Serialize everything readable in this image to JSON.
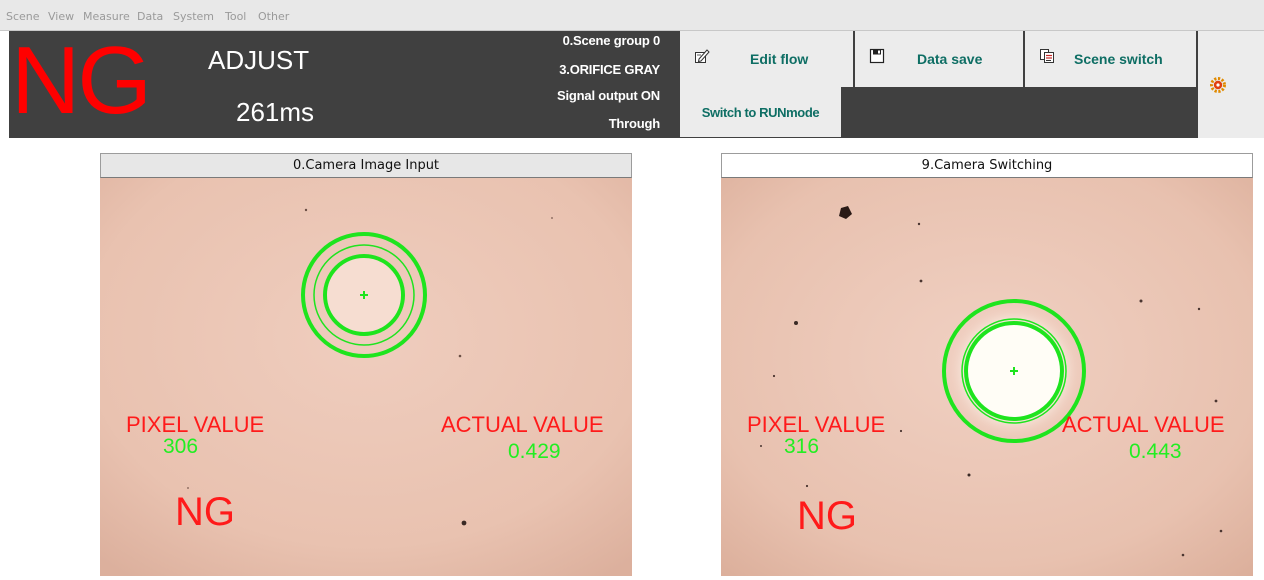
{
  "menu": [
    "Scene",
    "View",
    "Measure",
    "Data",
    "System",
    "Tool",
    "Other"
  ],
  "status": {
    "judgement": "NG",
    "mode": "ADJUST",
    "processing_time": "261ms",
    "scene_group": "0.Scene group 0",
    "scene": "3.ORIFICE GRAY",
    "signal_output": "Signal output ON",
    "through": "Through"
  },
  "toolbar": {
    "edit_flow": "Edit flow",
    "data_save": "Data save",
    "scene_switch": "Scene switch",
    "switch_mode": "Switch to RUNmode"
  },
  "colors": {
    "ng": "#ff0000",
    "overlay_label": "#ff1a1a",
    "overlay_value": "#22ee22",
    "button_text": "#0e6e64",
    "status_bar": "#404040"
  },
  "panes": [
    {
      "title": "0.Camera Image Input",
      "pixel_label": "PIXEL VALUE",
      "pixel_value": "306",
      "actual_label": "ACTUAL VALUE",
      "actual_value": "0.429",
      "judgement": "NG"
    },
    {
      "title": "9.Camera Switching",
      "pixel_label": "PIXEL VALUE",
      "pixel_value": "316",
      "actual_label": "ACTUAL VALUE",
      "actual_value": "0.443",
      "judgement": "NG"
    }
  ]
}
